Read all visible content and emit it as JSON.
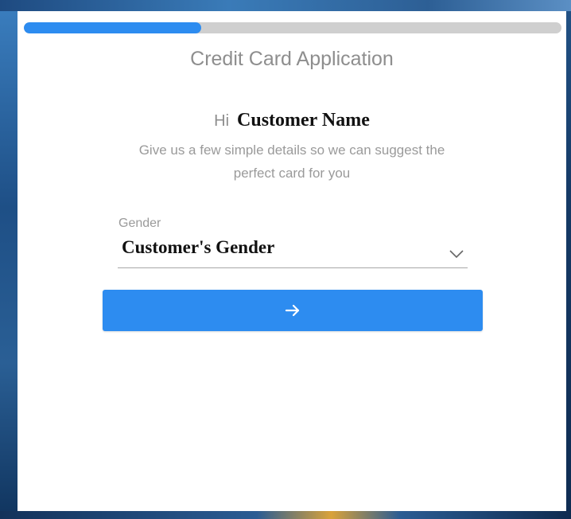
{
  "progress": {
    "fraction": 0.33
  },
  "form": {
    "title": "Credit Card Application",
    "greeting_prefix": "Hi",
    "customer_name": "Customer Name",
    "subtitle": "Give us a few simple details so we can suggest the perfect card for you",
    "gender_label": "Gender",
    "gender_value": "Customer's Gender"
  },
  "next_button": {
    "icon": "arrow-right-icon"
  },
  "colors": {
    "accent": "#2d8cf0",
    "track": "#cfcfcf",
    "muted_text": "#8e8e8e"
  }
}
